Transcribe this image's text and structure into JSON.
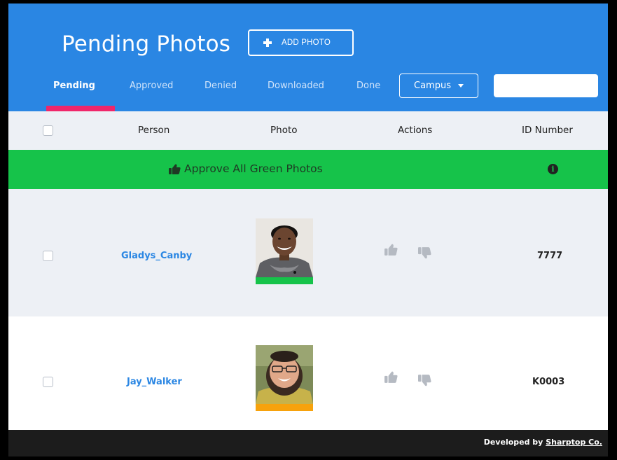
{
  "header": {
    "title": "Pending Photos",
    "add_photo_label": "ADD PHOTO",
    "campus_label": "Campus",
    "search_placeholder": ""
  },
  "tabs": [
    {
      "label": "Pending",
      "active": true
    },
    {
      "label": "Approved",
      "active": false
    },
    {
      "label": "Denied",
      "active": false
    },
    {
      "label": "Downloaded",
      "active": false
    },
    {
      "label": "Done",
      "active": false
    }
  ],
  "table": {
    "columns": [
      "Person",
      "Photo",
      "Actions",
      "ID Number"
    ],
    "approve_all_label": "Approve All Green Photos",
    "info_glyph": "i",
    "rows": [
      {
        "person": "Gladys_Canby",
        "id_number": "7777",
        "status_color": "#16c34a"
      },
      {
        "person": "Jay_Walker",
        "id_number": "K0003",
        "status_color": "#f7a20c"
      }
    ]
  },
  "footer": {
    "prefix": "Developed by ",
    "link": "Sharptop Co."
  },
  "colors": {
    "brand_blue": "#2a86e3",
    "tab_underline": "#f0266a",
    "approve_green": "#16c34a",
    "pending_orange": "#f7a20c"
  },
  "icons": {
    "add": "plus-icon",
    "campus_dropdown": "caret-down-icon",
    "approve": "thumbs-up-icon",
    "deny": "thumbs-down-icon",
    "info": "info-circle-icon"
  }
}
